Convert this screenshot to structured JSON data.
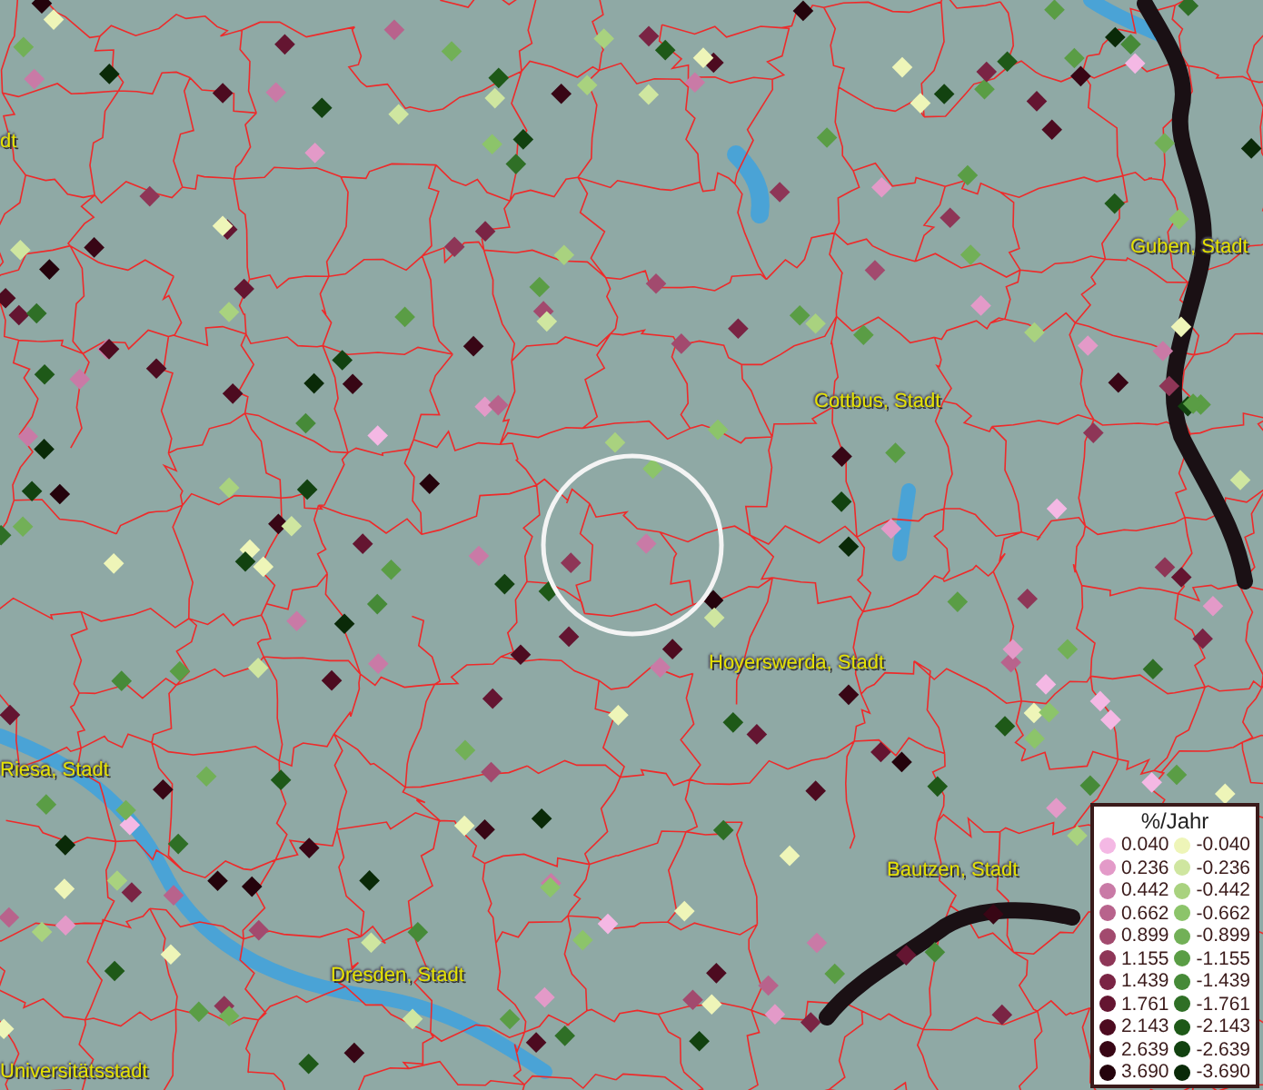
{
  "map_labels": [
    {
      "text": "dt"
    },
    {
      "text": "Guben, Stadt"
    },
    {
      "text": "Cottbus, Stadt"
    },
    {
      "text": "Hoyerswerda, Stadt"
    },
    {
      "text": "Riesa, Stadt"
    },
    {
      "text": "Bautzen, Stadt"
    },
    {
      "text": "Dresden, Stadt"
    },
    {
      "text": "Universitätsstadt"
    }
  ],
  "legend": {
    "title": "%/Jahr",
    "positive": [
      {
        "label": "0.040",
        "color": "#f4b8e4"
      },
      {
        "label": "0.236",
        "color": "#e39ac8"
      },
      {
        "label": "0.442",
        "color": "#c97aa6"
      },
      {
        "label": "0.662",
        "color": "#b8638c"
      },
      {
        "label": "0.899",
        "color": "#a24a6e"
      },
      {
        "label": "1.155",
        "color": "#8e3657"
      },
      {
        "label": "1.439",
        "color": "#7a2444"
      },
      {
        "label": "1.761",
        "color": "#641531"
      },
      {
        "label": "2.143",
        "color": "#4d0b20"
      },
      {
        "label": "2.639",
        "color": "#380615"
      },
      {
        "label": "3.690",
        "color": "#24030c"
      }
    ],
    "negative": [
      {
        "label": "-0.040",
        "color": "#eef5b8"
      },
      {
        "label": "-0.236",
        "color": "#cfe6a0"
      },
      {
        "label": "-0.442",
        "color": "#a9d27f"
      },
      {
        "label": "-0.662",
        "color": "#8cc46a"
      },
      {
        "label": "-0.899",
        "color": "#72b057"
      },
      {
        "label": "-1.155",
        "color": "#5a9d45"
      },
      {
        "label": "-1.439",
        "color": "#468a38"
      },
      {
        "label": "-1.761",
        "color": "#2f6f26"
      },
      {
        "label": "-2.143",
        "color": "#1e5918"
      },
      {
        "label": "-2.639",
        "color": "#124210"
      },
      {
        "label": "-3.690",
        "color": "#0a2a08"
      }
    ]
  }
}
